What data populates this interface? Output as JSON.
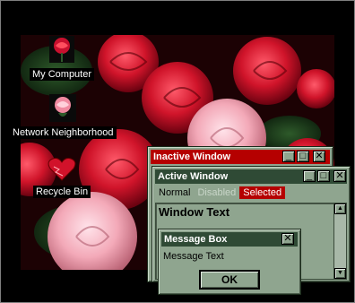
{
  "desktop": {
    "icons": [
      {
        "label": "My Computer"
      },
      {
        "label": "Network Neighborhood"
      },
      {
        "label": "Recycle Bin"
      }
    ]
  },
  "inactive_window": {
    "title": "Inactive Window",
    "title_color": "#b50000"
  },
  "active_window": {
    "title": "Active Window",
    "title_color": "#2f4a35",
    "menu": {
      "normal": "Normal",
      "disabled": "Disabled",
      "selected": "Selected"
    },
    "selected_color": "#b50000",
    "window_text": "Window Text"
  },
  "message_box": {
    "title": "Message Box",
    "text": "Message Text",
    "ok_label": "OK"
  },
  "colors": {
    "face": "#8fa58f",
    "background": "#000000"
  }
}
